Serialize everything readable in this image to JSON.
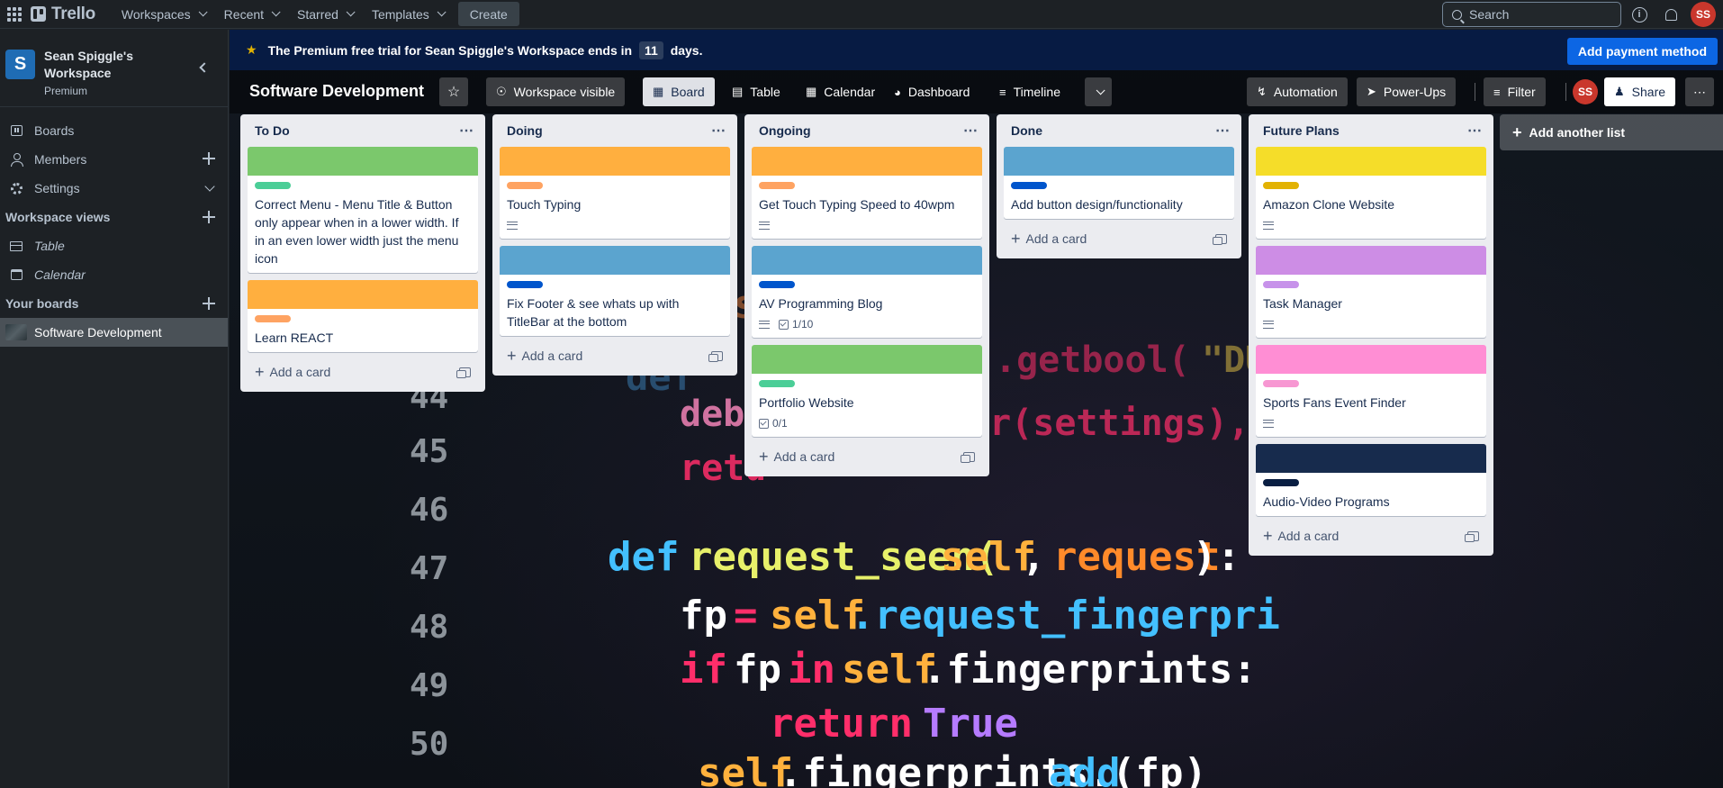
{
  "topbar": {
    "logo": "Trello",
    "nav": [
      "Workspaces",
      "Recent",
      "Starred",
      "Templates"
    ],
    "create": "Create",
    "search_placeholder": "Search",
    "avatar": "SS"
  },
  "sidebar": {
    "workspace_initial": "S",
    "workspace_name": "Sean Spiggle's Workspace",
    "workspace_plan": "Premium",
    "items": [
      {
        "label": "Boards",
        "icon": "board-icon"
      },
      {
        "label": "Members",
        "icon": "member-icon"
      },
      {
        "label": "Settings",
        "icon": "gear-icon"
      }
    ],
    "views_heading": "Workspace views",
    "views": [
      {
        "label": "Table",
        "icon": "table-icon"
      },
      {
        "label": "Calendar",
        "icon": "calendar-icon"
      }
    ],
    "boards_heading": "Your boards",
    "boards": [
      {
        "label": "Software Development"
      }
    ]
  },
  "banner": {
    "text_before": "The Premium free trial for Sean Spiggle's Workspace ends in",
    "days": "11",
    "text_after": "days.",
    "button": "Add payment method"
  },
  "boardbar": {
    "title": "Software Development",
    "visibility": "Workspace visible",
    "views": [
      "Board",
      "Table",
      "Calendar",
      "Dashboard",
      "Timeline"
    ],
    "automation": "Automation",
    "powerups": "Power-Ups",
    "filter": "Filter",
    "avatar": "SS",
    "share": "Share"
  },
  "lists": [
    {
      "title": "To Do",
      "cards": [
        {
          "cover": "#7bc86c",
          "label": "#4bce97",
          "title": "Correct Menu - Menu Title & Button only appear when in a lower width. If in an even lower width just the menu icon",
          "desc": false,
          "checklist": ""
        },
        {
          "cover": "#ffaf3f",
          "label": "#fea362",
          "title": "Learn REACT",
          "desc": false,
          "checklist": ""
        }
      ]
    },
    {
      "title": "Doing",
      "cards": [
        {
          "cover": "#ffaf3f",
          "label": "#fea362",
          "title": "Touch Typing",
          "desc": true,
          "checklist": ""
        },
        {
          "cover": "#5ba4cf",
          "label": "#0055cc",
          "title": "Fix Footer & see whats up with TitleBar at the bottom",
          "desc": false,
          "checklist": ""
        }
      ]
    },
    {
      "title": "Ongoing",
      "cards": [
        {
          "cover": "#ffaf3f",
          "label": "#fea362",
          "title": "Get Touch Typing Speed to 40wpm",
          "desc": true,
          "checklist": ""
        },
        {
          "cover": "#5ba4cf",
          "label": "#0055cc",
          "title": "AV Programming Blog",
          "desc": true,
          "checklist": "1/10"
        },
        {
          "cover": "#7bc86c",
          "label": "#4bce97",
          "title": "Portfolio Website",
          "desc": false,
          "checklist": "0/1"
        }
      ]
    },
    {
      "title": "Done",
      "cards": [
        {
          "cover": "#5ba4cf",
          "label": "#0055cc",
          "title": "Add button design/functionality",
          "desc": false,
          "checklist": ""
        }
      ]
    },
    {
      "title": "Future Plans",
      "cards": [
        {
          "cover": "#f5dd29",
          "label": "#e2b203",
          "title": "Amazon Clone Website",
          "desc": true,
          "checklist": ""
        },
        {
          "cover": "#cd8de5",
          "label": "#c792ea",
          "title": "Task Manager",
          "desc": true,
          "checklist": ""
        },
        {
          "cover": "#ff8ed4",
          "label": "#f797d2",
          "title": "Sports Fans Event Finder",
          "desc": true,
          "checklist": ""
        },
        {
          "cover": "#172b4d",
          "label": "#091e42",
          "title": "Audio-Video Programs",
          "desc": false,
          "checklist": ""
        }
      ]
    }
  ],
  "add_card_label": "Add a card",
  "add_list_label": "Add another list"
}
